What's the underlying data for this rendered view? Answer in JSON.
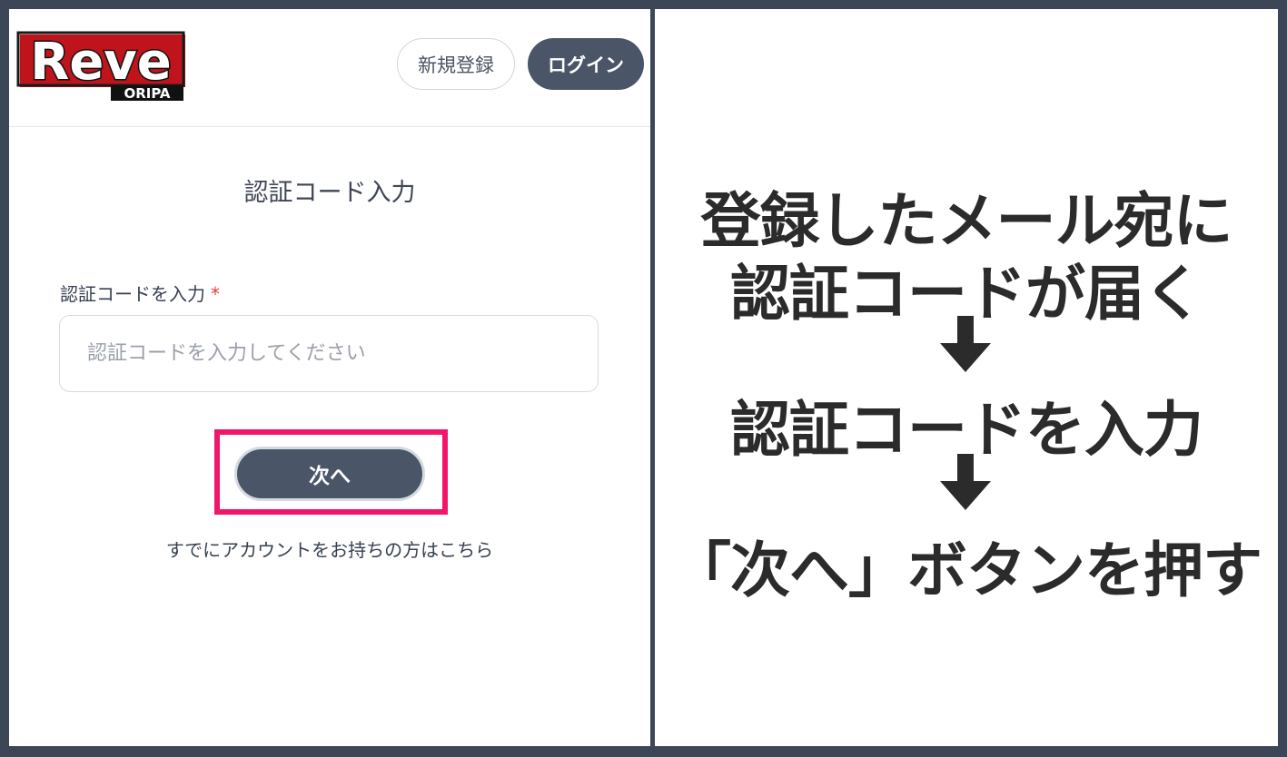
{
  "header": {
    "logo_text": "Reve",
    "logo_subtext": "ORIPA",
    "register_label": "新規登録",
    "login_label": "ログイン"
  },
  "form": {
    "title": "認証コード入力",
    "code_label": "認証コードを入力",
    "required_mark": "*",
    "code_placeholder": "認証コードを入力してください",
    "code_value": "",
    "next_label": "次へ",
    "account_link": "すでにアカウントをお持ちの方はこちら"
  },
  "instructions": {
    "line1": "登録したメール宛に",
    "line2": "認証コードが届く",
    "line3": "認証コードを入力",
    "line4": "「次へ」ボタンを押す"
  },
  "colors": {
    "frame": "#3d4657",
    "button_dark": "#4a5568",
    "highlight": "#f0176b",
    "logo_red": "#c0141c"
  },
  "icons": [
    "arrow-down-icon",
    "arrow-down-icon"
  ]
}
